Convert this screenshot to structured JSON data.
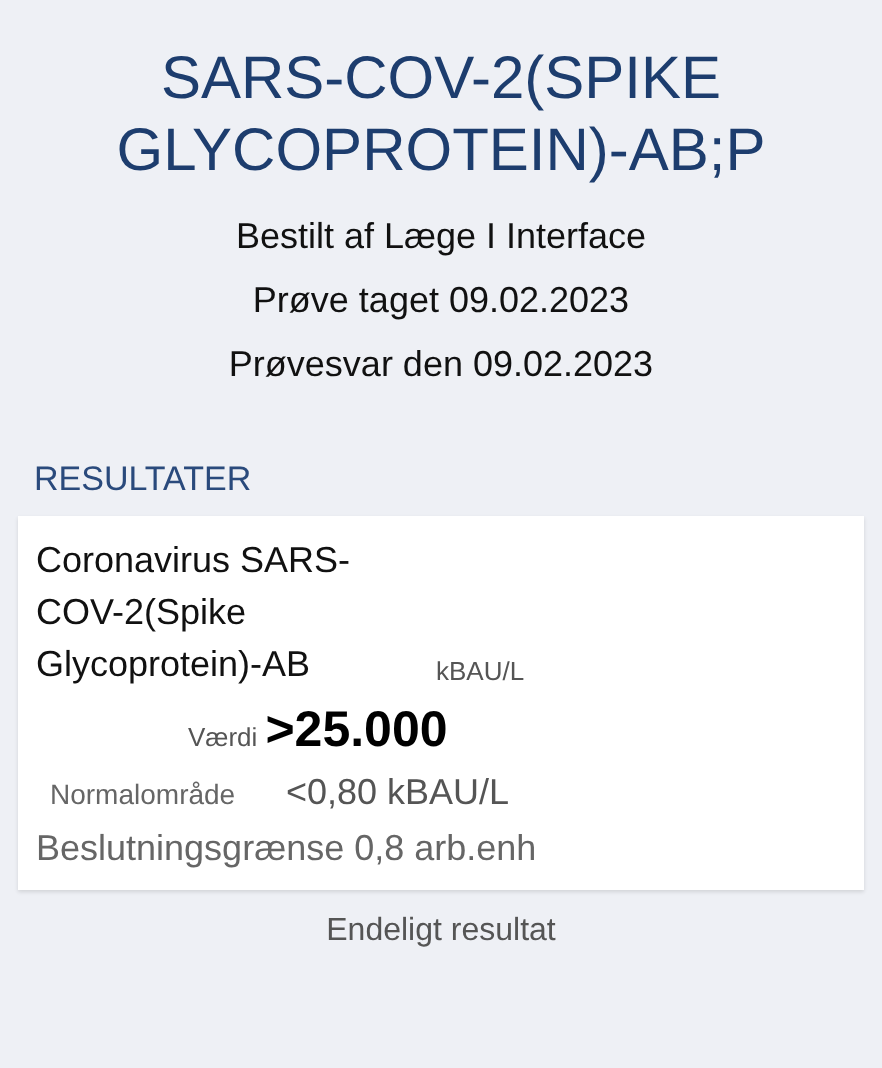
{
  "header": {
    "title": "SARS-COV-2(SPIKE GLYCOPROTEIN)-AB;P",
    "details": [
      "Bestilt af Læge I Interface",
      "Prøve taget 09.02.2023",
      "Prøvesvar den 09.02.2023"
    ]
  },
  "section": {
    "heading": "RESULTATER"
  },
  "result": {
    "name": "Coronavirus SARS-COV-2(Spike Glycoprotein)-AB",
    "unit": "kBAU/L",
    "value_label": "Værdi",
    "value": ">25.000",
    "range_label": "Normalområde",
    "range": "<0,80 kBAU/L",
    "note": "Beslutningsgrænse 0,8 arb.enh"
  },
  "status": "Endeligt resultat"
}
